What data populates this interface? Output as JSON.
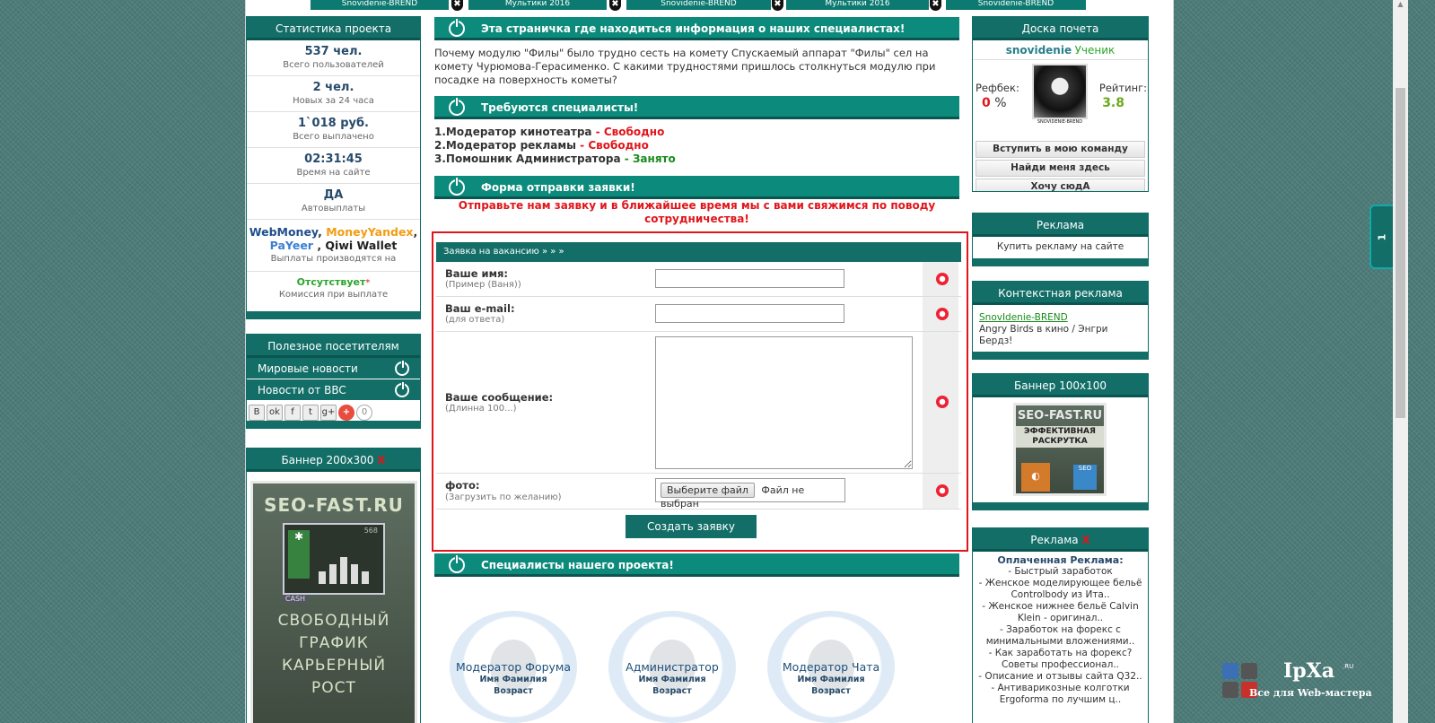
{
  "topnav": {
    "items": [
      "Snovidenie-BREND",
      "Мультики 2016",
      "Snovidenie-BREND",
      "Мультики 2016",
      "Snovidenie-BREND"
    ]
  },
  "stats": {
    "title": "Статистика проекта",
    "items": [
      {
        "value": "537 чел.",
        "label": "Всего пользователей"
      },
      {
        "value": "2 чел.",
        "label": "Новых за 24 часа"
      },
      {
        "value": "1`018 руб.",
        "label": "Всего выплачено"
      },
      {
        "value": "02:31:45",
        "label": "Время на сайте"
      },
      {
        "value": "ДА",
        "label": "Автовыплаты"
      }
    ],
    "payments": {
      "webmoney": "WebMoney",
      "sep1": ", ",
      "moneyyandex": "MoneyYandex",
      "sep2": ",",
      "payeer": "PaYeer",
      "sep3": " , ",
      "qiwi": "Qiwi Wallet",
      "label": "Выплаты производятся на"
    },
    "commission": {
      "value": "Отсутствует",
      "star": "*",
      "label": "Комиссия при выплате"
    }
  },
  "useful": {
    "title": "Полезное посетителям",
    "links": [
      "Мировые новости",
      "Новости от BBC"
    ],
    "social": [
      "B",
      "ok",
      "f",
      "t",
      "g+",
      "+"
    ],
    "count": "0"
  },
  "banner200": {
    "title": "Баннер 200x300",
    "close": "X",
    "brand": "SEO-FAST.RU",
    "num": "568",
    "cash": "CASH",
    "lines": [
      "СВОБОДНЫЙ",
      "ГРАФИК",
      "КАРЬЕРНЫЙ",
      "РОСТ"
    ]
  },
  "main": {
    "sec1": "Эта страничка где находиться информация о наших специалистах!",
    "intro": "Почему модулю \"Филы\" было трудно сесть на комету Спускаемый аппарат \"Филы\" сел на комету Чурюмова-Герасименко. С какими трудностями пришлось столкнуться модулю при посадке на поверхность кометы?",
    "sec2": "Требуются специалисты!",
    "jobs": [
      {
        "name": "1.Модератор кинотеатра",
        "sep": " - ",
        "status": "Свободно"
      },
      {
        "name": "2.Модератор рекламы",
        "sep": " - ",
        "status": "Свободно"
      },
      {
        "name": "3.Помошник Администратора",
        "sep": " - ",
        "status": "Занято"
      }
    ],
    "sec3": "Форма отправки заявки!",
    "notice": "Отправьте нам заявку и в ближайшее время мы с вами свяжимся по поводу сотрудничества!",
    "form": {
      "title": "Заявка на вакансию » » »",
      "name": {
        "label": "Ваше имя:",
        "hint": "(Пример (Ваня))",
        "value": ""
      },
      "email": {
        "label": "Ваш e-mail:",
        "hint": "(для ответа)",
        "value": ""
      },
      "message": {
        "label": "Ваше сообщение:",
        "hint": "(Длинна 100...)",
        "value": ""
      },
      "photo": {
        "label": "фото:",
        "hint": "(Загрузить по желанию)",
        "button": "Выберите файл",
        "status": "Файл не выбран"
      },
      "submit": "Создать заявку"
    },
    "sec4": "Специалисты нашего проекта!",
    "specialists": [
      {
        "role": "Модератор Форума",
        "name": "Имя Фамилия",
        "age": "Возраст"
      },
      {
        "role": "Администратор",
        "name": "Имя Фамилия",
        "age": "Возраст"
      },
      {
        "role": "Модератор Чата",
        "name": "Имя Фамилия",
        "age": "Возраст"
      }
    ]
  },
  "honor": {
    "title": "Доска почета",
    "user": "snovidenie",
    "rank": "Ученик",
    "refbek_label": "Рефбек:",
    "refbek_value": "0",
    "refbek_unit": " %",
    "rating_label": "Рейтинг:",
    "rating_value": "3.8",
    "avatar_caption": "SNOVIDENIE-BREND",
    "buttons": [
      "Вступить в мою команду",
      "Найди меня здесь",
      "Хочу сюдА"
    ]
  },
  "ads1": {
    "title": "Реклама",
    "link": "Купить рекламу на сайте"
  },
  "context": {
    "title": "Контекстная реклама",
    "link": "SnovIdenie-BREND",
    "text": "Angry Birds в кино / Энгри Бердз!"
  },
  "banner100": {
    "title": "Баннер 100x100",
    "brand": "SEO-FAST.RU",
    "text": [
      "ЭФФЕКТИВНАЯ",
      "РАСКРУТКА"
    ],
    "seo": "SEO"
  },
  "ads2": {
    "title": "Реклама",
    "close": "X",
    "heading": "Оплаченная Реклама:",
    "items": [
      "- Быстрый заработок",
      "- Женское моделирующее бельё Controlbody из Ита..",
      "- Женское нижнее бельё Calvin Klein - оригинал..",
      "- Заработок на форекс с минимальными вложениями..",
      "- Как заработать на форекс? Советы профессионал..",
      "- Описание и отзывы сайта Q32..",
      "- Антиварикозные колготки Ergoforma по лучшим ц.."
    ]
  },
  "sidetab": {
    "label": "1"
  },
  "watermark": {
    "brand": "IpXa",
    "ru": ".RU",
    "tagline": "Все для Web-мастера"
  },
  "colors": {
    "teal": "#136e68",
    "red": "#e0161b",
    "green": "#1a8a1a"
  }
}
